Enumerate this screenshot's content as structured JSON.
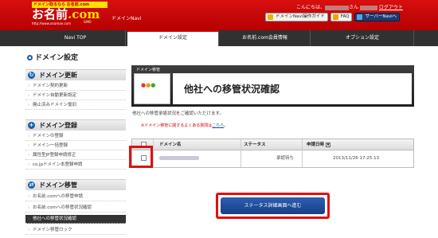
{
  "header": {
    "logo_tag": "ドメイン取るなら お名前.com",
    "logo_name_main": "お名前",
    "logo_name_com": ".com",
    "logo_url": "http://www.onamae.com",
    "logo_sub": "GMO",
    "app_name": "ドメインNavi",
    "greeting_prefix": "こんにちは、",
    "greeting_suffix": "さん",
    "logout": "ログアウト",
    "buttons": [
      {
        "label": "ドメインNavi操作ガイド",
        "icon": "guide-icon"
      },
      {
        "label": "FAQ",
        "icon": "faq-icon"
      },
      {
        "label": "サーバーNaviへ",
        "icon": "server-icon"
      }
    ]
  },
  "nav": {
    "tabs": [
      "Navi TOP",
      "ドメイン設定",
      "お名前.com会員情報",
      "オプション設定"
    ],
    "active_index": 1
  },
  "sidebar": {
    "title": "ドメイン設定",
    "sections": [
      {
        "title": "ドメイン更新",
        "items": [
          "ドメイン契約更新",
          "ドメイン自動更新設定",
          "廃止済みドメイン復旧"
        ]
      },
      {
        "title": "ドメイン登録",
        "items": [
          "ドメインの登録",
          "ドメイン一括登録",
          "属性型JP登録申請修正",
          "co.jpドメイン本登録申請"
        ]
      },
      {
        "title": "ドメイン移管",
        "items": [
          "お名前.comへの移管申請",
          "お名前.comへの移管状況確認",
          "他社への移管状況確認",
          "ドメイン移管ロック"
        ]
      }
    ],
    "active_item": "他社への移管状況確認"
  },
  "main": {
    "header_small": "ドメイン移管",
    "title": "他社への移管状況確認",
    "description": "他社への移管承諾状況をご確認いただけます。",
    "note_prefix": "※ドメイン移管に関するよくある質問は",
    "note_link": "こちら",
    "note_suffix": "。",
    "table": {
      "headers": [
        "ドメイン名",
        "ステータス",
        "申請日時"
      ],
      "rows": [
        {
          "status": "承認待ち",
          "date": "2013/11/26 17:25:13"
        }
      ]
    },
    "button_label": "ステータス詳細画面へ進む"
  },
  "colors": {
    "brand_red": "#c80000",
    "nav_dark": "#313131",
    "accent_blue": "#1a5fa8",
    "highlight": "#e01010"
  }
}
